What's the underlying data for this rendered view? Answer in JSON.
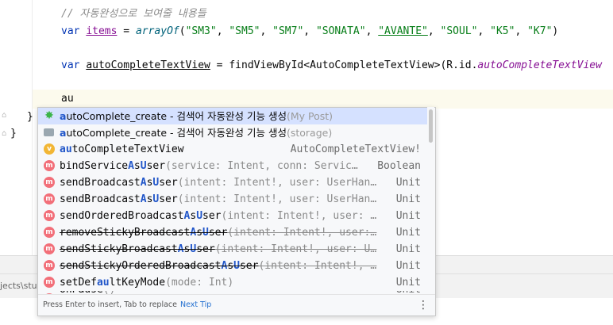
{
  "editor": {
    "comment": "// 자동완성으로 보여줄 내용들",
    "line_items": {
      "kw": "var",
      "name": "items",
      "assign": " = ",
      "fn": "arrayOf",
      "open": "(",
      "s1": "\"SM3\"",
      "s2": "\"SM5\"",
      "s3": "\"SM7\"",
      "s4": "\"SONATA\"",
      "s5": "\"AVANTE\"",
      "s6": "\"SOUL\"",
      "s7": "\"K5\"",
      "s8": "\"K7\"",
      "sep": ", ",
      "close": ")"
    },
    "line_actv": {
      "kw": "var",
      "name": "autoCompleteTextView",
      "assign": " = findViewById<AutoCompleteTextView>(R.id.",
      "id": "autoCompleteTextView"
    },
    "typed": "au",
    "brace1": "}",
    "brace2": "}"
  },
  "status": {
    "path": "jects\\stu"
  },
  "completion": {
    "items": [
      {
        "icon": "live-template-icon",
        "hl": "a",
        "rest1": "utoComplete_create - 검색어 자동완성 기능 생성",
        "hint": "(My Post)",
        "type": ""
      },
      {
        "icon": "folder-icon",
        "hl": "a",
        "rest1": "utoComplete_create - 검색어 자동완성 기능 생성",
        "hint": "(storage)",
        "type": ""
      },
      {
        "icon": "v",
        "hl": "au",
        "rest1": "toCompleteTextView",
        "params": "",
        "type": "AutoCompleteTextView!"
      },
      {
        "icon": "m",
        "pre": "bindService",
        "hl": "A",
        "mid": "s",
        "hl2": "U",
        "rest1": "ser",
        "params": "(service: Intent, conn: Servic…",
        "type": "Boolean"
      },
      {
        "icon": "m",
        "pre": "sendBroadcast",
        "hl": "A",
        "mid": "s",
        "hl2": "U",
        "rest1": "ser",
        "params": "(intent: Intent!, user: UserHan…",
        "type": "Unit"
      },
      {
        "icon": "m",
        "pre": "sendBroadcast",
        "hl": "A",
        "mid": "s",
        "hl2": "U",
        "rest1": "ser",
        "params": "(intent: Intent!, user: UserHan…",
        "type": "Unit"
      },
      {
        "icon": "m",
        "pre": "sendOrderedBroadcast",
        "hl": "A",
        "mid": "s",
        "hl2": "U",
        "rest1": "ser",
        "params": "(intent: Intent!, user: …",
        "type": "Unit"
      },
      {
        "icon": "m",
        "pre": "removeStickyBroadcast",
        "hl": "A",
        "mid": "s",
        "hl2": "U",
        "rest1": "ser",
        "params": "(intent: Intent!, user:…",
        "type": "Unit",
        "deprecated": true
      },
      {
        "icon": "m",
        "pre": "sendStickyBroadcast",
        "hl": "A",
        "mid": "s",
        "hl2": "U",
        "rest1": "ser",
        "params": "(intent: Intent!, user: U…",
        "type": "Unit",
        "deprecated": true
      },
      {
        "icon": "m",
        "pre": "sendStickyOrderedBroadcast",
        "hl": "A",
        "mid": "s",
        "hl2": "U",
        "rest1": "ser",
        "params": "(intent: Intent!, …",
        "type": "Unit",
        "deprecated": true
      },
      {
        "icon": "m",
        "pre": "setDef",
        "hl": "au",
        "mid": "",
        "hl2": "",
        "rest1": "ltKeyMode",
        "params": "(mode: Int)",
        "type": "Unit"
      },
      {
        "icon": "m",
        "pre": "onPause",
        "hl": "",
        "mid": "",
        "hl2": "",
        "rest1": "",
        "params": "()",
        "type": "Unit"
      }
    ],
    "footer_text": "Press Enter to insert, Tab to replace",
    "next_tip": "Next Tip",
    "icon_letters": {
      "m": "m",
      "v": "v"
    }
  }
}
